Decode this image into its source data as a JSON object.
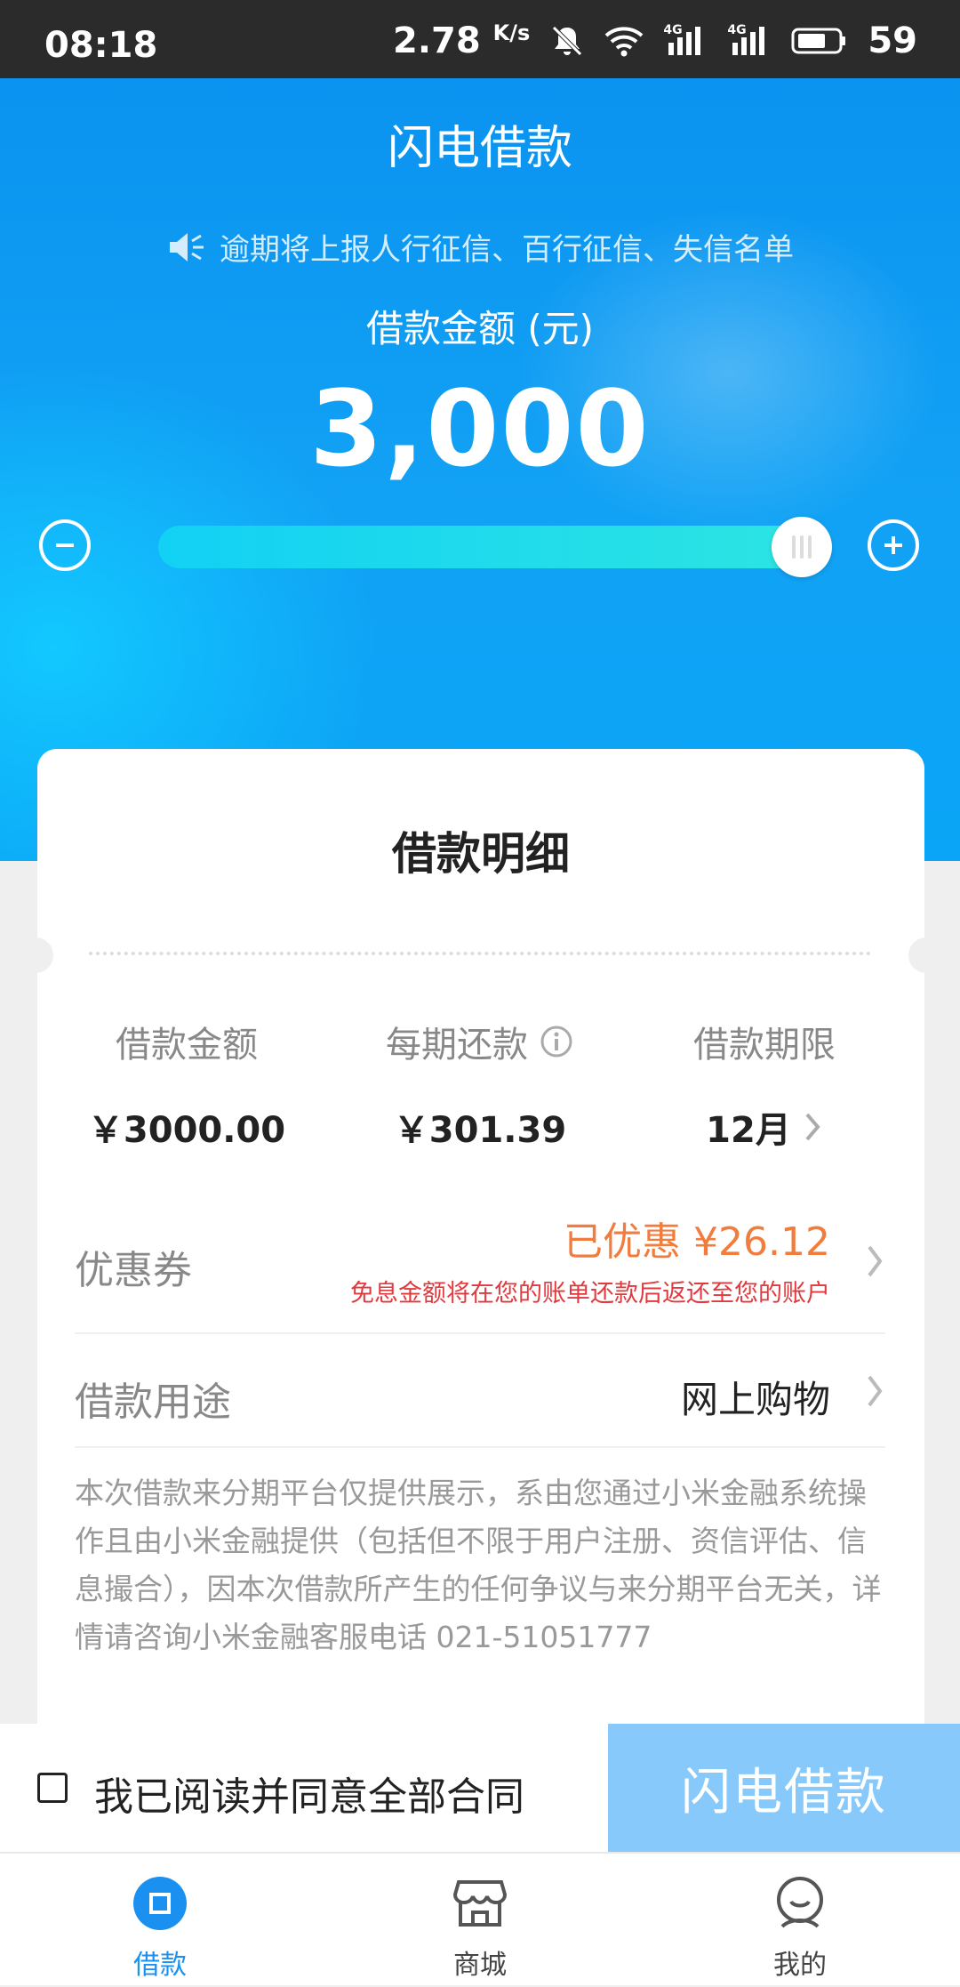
{
  "status_bar": {
    "time": "08:18",
    "speed": "2.78",
    "speed_unit": "K/s",
    "network1": "4G",
    "network2": "4G",
    "battery": "59"
  },
  "hero": {
    "title": "闪电借款",
    "notice": "逾期将上报人行征信、百行征信、失信名单",
    "amount_label": "借款金额 (元)",
    "amount_value": "3,000",
    "slider_fraction": 1.0
  },
  "card": {
    "title": "借款明细",
    "columns": [
      {
        "label": "借款金额",
        "value": "￥3000.00"
      },
      {
        "label": "每期还款",
        "value": "￥301.39"
      },
      {
        "label": "借款期限",
        "value": "12月"
      }
    ],
    "coupon": {
      "label": "优惠券",
      "value": "已优惠 ¥26.12",
      "note": "免息金额将在您的账单还款后返还至您的账户"
    },
    "purpose": {
      "label": "借款用途",
      "value": "网上购物"
    },
    "disclaimer": "本次借款来分期平台仅提供展示，系由您通过小米金融系统操作且由小米金融提供（包括但不限于用户注册、资信评估、信息撮合），因本次借款所产生的任何争议与来分期平台无关，详情请咨询小米金融客服电话 021-51051777"
  },
  "agree": {
    "text": "我已阅读并同意全部合同",
    "submit": "闪电借款"
  },
  "tabs": [
    {
      "label": "借款",
      "icon": "loan-icon",
      "active": true
    },
    {
      "label": "商城",
      "icon": "store-icon",
      "active": false
    },
    {
      "label": "我的",
      "icon": "profile-icon",
      "active": false
    }
  ],
  "colors": {
    "brand_blue": "#1a91f0",
    "discount_orange": "#f07c3e",
    "note_red": "#e0393e",
    "submit_disabled": "#86c9fa"
  }
}
